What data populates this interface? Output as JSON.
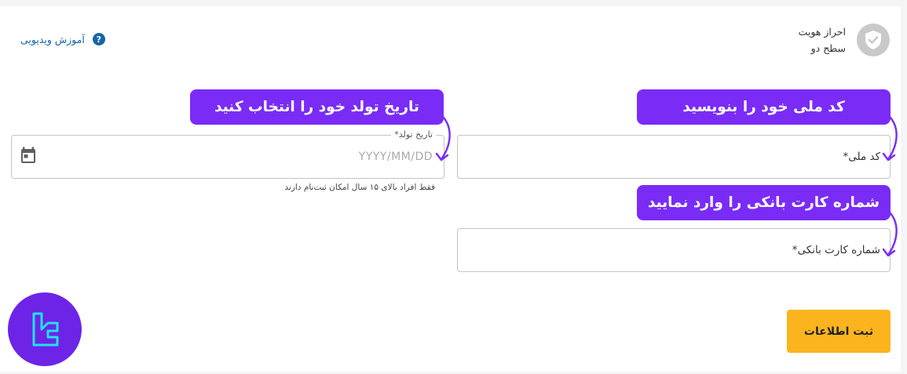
{
  "header": {
    "title": "احراز هویت",
    "subtitle": "سطح دو",
    "icon": "shield-check-icon"
  },
  "video_link": {
    "label": "آموزش ویدیویی",
    "icon": "help-icon"
  },
  "form": {
    "national_code": {
      "label": "کد ملی*"
    },
    "birth_date": {
      "label": "تاریخ تولد*",
      "placeholder": "YYYY/MM/DD",
      "helper": "فقط افراد بالای ۱۵ سال امکان ثبت‌نام دارند",
      "icon": "calendar-icon"
    },
    "card_number": {
      "label": "شماره کارت بانکی*"
    },
    "submit_label": "ثبت اطلاعات"
  },
  "callouts": {
    "national_code": "کد ملی خود را بنویسید",
    "birth_date": "تاریخ تولد خود را انتخاب کنید",
    "card_number": "شماره کارت بانکی را وارد نمایید"
  },
  "colors": {
    "callout": "#7a2cf6",
    "submit": "#fbb41e",
    "link": "#1565a8",
    "logo": "#6e24e6",
    "logo_accent": "#1ee3f0"
  },
  "logo": {
    "icon": "brand-logo"
  }
}
